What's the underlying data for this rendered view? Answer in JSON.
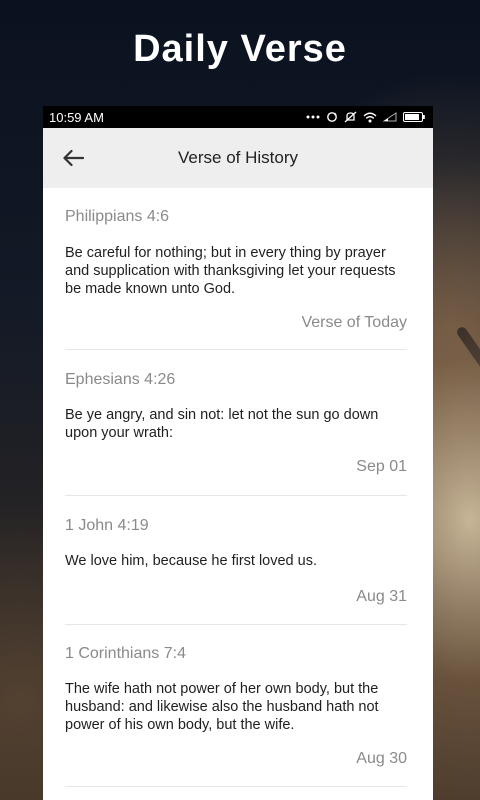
{
  "promo_title": "Daily Verse",
  "status_bar": {
    "time": "10:59 AM"
  },
  "toolbar": {
    "title": "Verse of History"
  },
  "verses": [
    {
      "reference": "Philippians 4:6",
      "text": "Be careful for nothing; but in every thing by prayer and supplication with thanksgiving let your requests be made known unto God.",
      "date": "Verse of Today"
    },
    {
      "reference": "Ephesians 4:26",
      "text": "Be ye angry, and sin not: let not the sun go down upon your wrath:",
      "date": "Sep 01"
    },
    {
      "reference": "1 John 4:19",
      "text": "We love him, because he first loved us.",
      "date": "Aug 31"
    },
    {
      "reference": "1 Corinthians 7:4",
      "text": "The wife hath not power of her own body, but the husband: and likewise also the husband hath not power of his own body, but the wife.",
      "date": "Aug 30"
    }
  ],
  "icons": {
    "back": "arrow-back-icon",
    "status": [
      "more-dots-icon",
      "sync-icon",
      "mute-icon",
      "wifi-icon",
      "signal-icon",
      "battery-icon"
    ]
  },
  "colors": {
    "toolbar_bg": "#eeeeee",
    "secondary_text": "#8a8a8a",
    "primary_text": "#1f1f1f"
  }
}
